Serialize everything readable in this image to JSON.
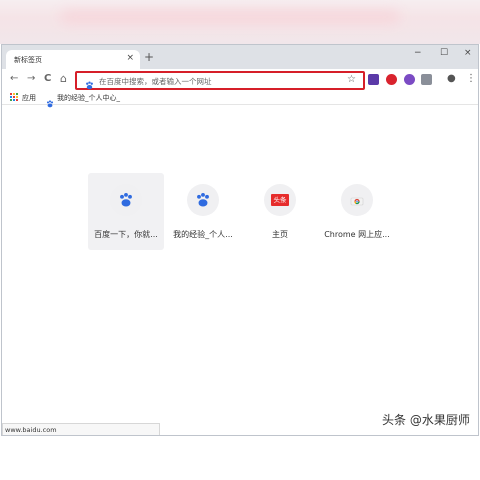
{
  "tab": {
    "title": "新标签页",
    "close": "×",
    "new_tab": "+"
  },
  "window_controls": {
    "minimize": "−",
    "maximize": "☐",
    "close": "×"
  },
  "nav": {
    "back": "←",
    "forward": "→",
    "reload": "C",
    "home": "⌂"
  },
  "omnibox": {
    "placeholder": "在百度中搜索，或者输入一个网址",
    "star": "☆"
  },
  "extensions": [
    {
      "name": "ext-1",
      "color": "#5b3aa8"
    },
    {
      "name": "ext-2",
      "color": "#d9232e"
    },
    {
      "name": "ext-3",
      "color": "#7b4bc4"
    },
    {
      "name": "ext-4",
      "color": "#8a8f99"
    }
  ],
  "toolbar_right": {
    "profile": "●",
    "menu": "⋮"
  },
  "bookmarks": {
    "apps_label": "应用",
    "item_label": "我的经验_个人中心_"
  },
  "tiles": [
    {
      "label": "百度一下，你就...",
      "icon": "baidu-paw-icon"
    },
    {
      "label": "我的经验_个人...",
      "icon": "baidu-paw-icon"
    },
    {
      "label": "主页",
      "icon": "toutiao-icon",
      "icon_text": "头条"
    },
    {
      "label": "Chrome 网上应...",
      "icon": "chrome-web-store-icon"
    }
  ],
  "status_bar": {
    "text": "www.baidu.com"
  },
  "watermark": {
    "text": "头条 @水果厨师"
  },
  "colors": {
    "omnibox_highlight": "#d61f29",
    "baidu_blue": "#2f6be0",
    "toutiao_red": "#e62c2c"
  }
}
